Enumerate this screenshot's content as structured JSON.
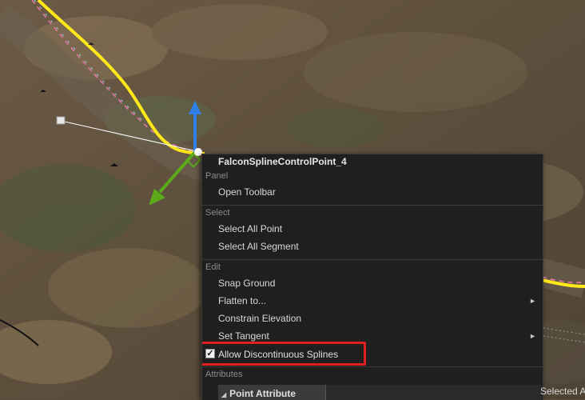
{
  "menu": {
    "title": "FalconSplineControlPoint_4",
    "sections": {
      "panel": "Panel",
      "select": "Select",
      "edit": "Edit",
      "attributes": "Attributes"
    },
    "items": {
      "open_toolbar": "Open Toolbar",
      "select_all_point": "Select All Point",
      "select_all_segment": "Select All Segment",
      "snap_ground": "Snap Ground",
      "flatten_to": "Flatten to...",
      "constrain_elevation": "Constrain Elevation",
      "set_tangent": "Set Tangent",
      "allow_discontinuous": "Allow Discontinuous Splines"
    },
    "allow_discontinuous_checked": true,
    "submenu_arrow": "►",
    "attribute_header": "Point Attribute"
  },
  "status": {
    "selected_text": "Selected A"
  },
  "colors": {
    "spline": "#ffe81a",
    "highlight": "#e02020",
    "gizmo_up": "#2f7fe8",
    "gizmo_side": "#5aaa1a"
  },
  "icons": {
    "checkmark": "✓",
    "expand": "◢"
  }
}
